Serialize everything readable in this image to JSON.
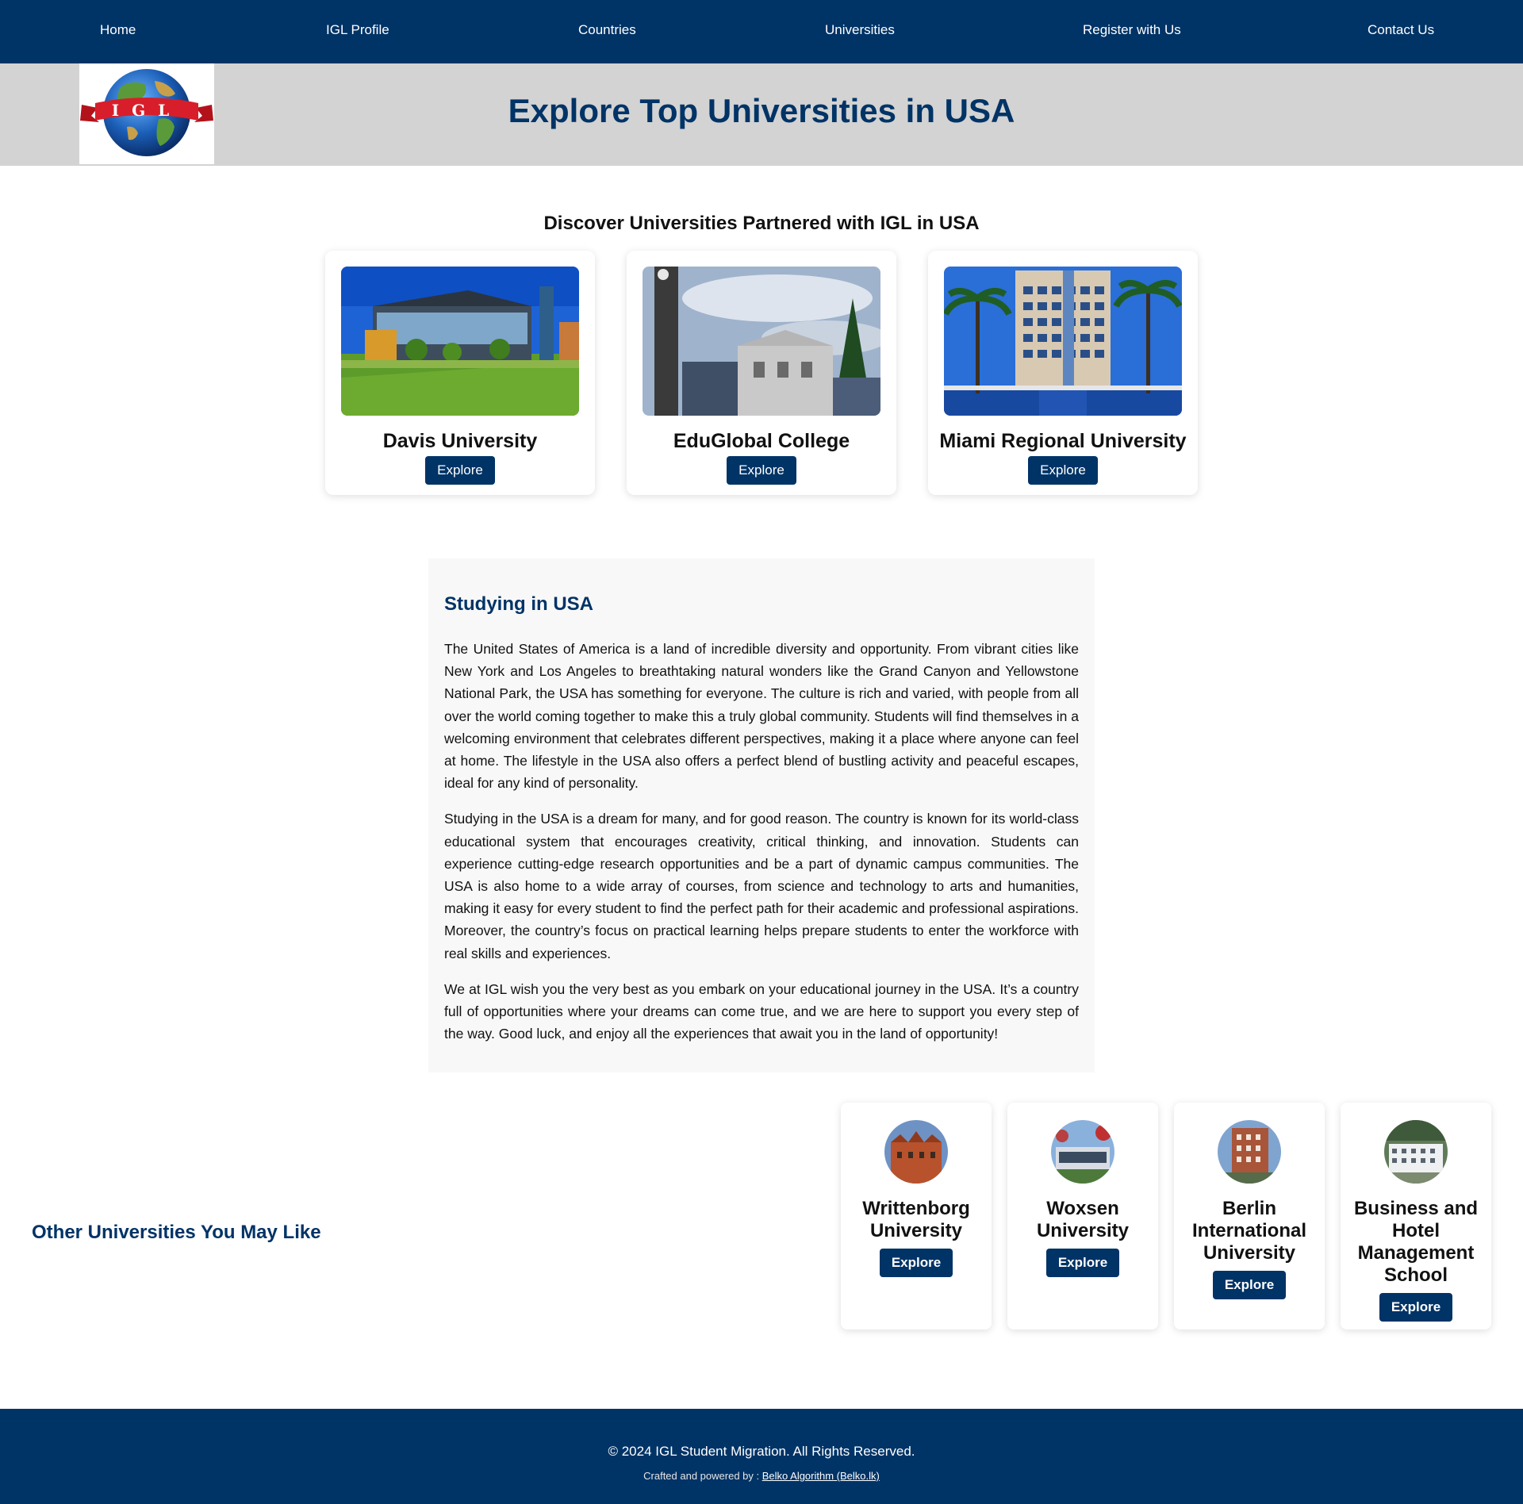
{
  "nav": {
    "items": [
      "Home",
      "IGL Profile",
      "Countries",
      "Universities",
      "Register with Us",
      "Contact Us"
    ]
  },
  "hero": {
    "logo_text": "IGL",
    "title": "Explore Top Universities in USA"
  },
  "partners": {
    "title": "Discover Universities Partnered with IGL in USA",
    "cards": [
      {
        "name": "Davis University",
        "button": "Explore"
      },
      {
        "name": "EduGlobal College",
        "button": "Explore"
      },
      {
        "name": "Miami Regional University",
        "button": "Explore"
      }
    ]
  },
  "study": {
    "title": "Studying in USA",
    "paragraphs": [
      "The United States of America is a land of incredible diversity and opportunity. From vibrant cities like New York and Los Angeles to breathtaking natural wonders like the Grand Canyon and Yellowstone National Park, the USA has something for everyone. The culture is rich and varied, with people from all over the world coming together to make this a truly global community. Students will find themselves in a welcoming environment that celebrates different perspectives, making it a place where anyone can feel at home. The lifestyle in the USA also offers a perfect blend of bustling activity and peaceful escapes, ideal for any kind of personality.",
      "Studying in the USA is a dream for many, and for good reason. The country is known for its world-class educational system that encourages creativity, critical thinking, and innovation. Students can experience cutting-edge research opportunities and be a part of dynamic campus communities. The USA is also home to a wide array of courses, from science and technology to arts and humanities, making it easy for every student to find the perfect path for their academic and professional aspirations. Moreover, the country’s focus on practical learning helps prepare students to enter the workforce with real skills and experiences.",
      "We at IGL wish you the very best as you embark on your educational journey in the USA. It’s a country full of opportunities where your dreams can come true, and we are here to support you every step of the way. Good luck, and enjoy all the experiences that await you in the land of opportunity!"
    ]
  },
  "other": {
    "title": "Other Universities You May Like",
    "cards": [
      {
        "name": "Writtenborg University",
        "button": "Explore"
      },
      {
        "name": "Woxsen University",
        "button": "Explore"
      },
      {
        "name": "Berlin International University",
        "button": "Explore"
      },
      {
        "name": "Business and Hotel Management School",
        "button": "Explore"
      }
    ]
  },
  "footer": {
    "copyright": "© 2024 IGL Student Migration. All Rights Reserved.",
    "credit_prefix": "Crafted and powered by : ",
    "credit_link": "Belko Algorithm (Belko.lk)"
  },
  "colors": {
    "brand_navy": "#003366",
    "hero_gray": "#d3d3d3",
    "panel_bg": "#f8f8f8"
  }
}
